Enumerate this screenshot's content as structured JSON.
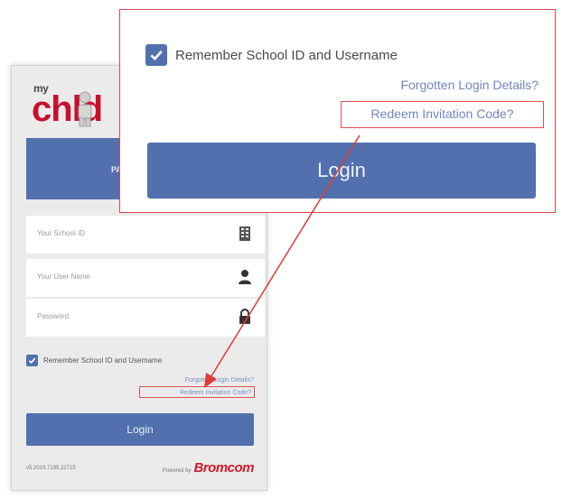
{
  "logo": {
    "prefix": "my",
    "word": "chld"
  },
  "tabs": {
    "active_label": "PA"
  },
  "fields": {
    "school_id_placeholder": "Your School ID",
    "username_placeholder": "Your User Name",
    "password_placeholder": "Password"
  },
  "remember": {
    "label": "Remember School ID and Username",
    "checked": true
  },
  "links": {
    "forgot_small": "Forgotten Login Details?",
    "redeem": "Redeem Invitation Code?",
    "forgot": "Forgotten Login Details?"
  },
  "buttons": {
    "login": "Login"
  },
  "footer": {
    "version": "v5.2019.7195.22715",
    "powered_by": "Powered by",
    "brand": "Bromcom"
  },
  "icons": {
    "school_id": "building-icon",
    "username": "user-icon",
    "password": "lock-icon",
    "checkbox": "checkmark-icon"
  },
  "colors": {
    "primary": "#5170ad",
    "highlight": "#e25050",
    "link": "#7186bd",
    "brand_red": "#c8102e"
  }
}
